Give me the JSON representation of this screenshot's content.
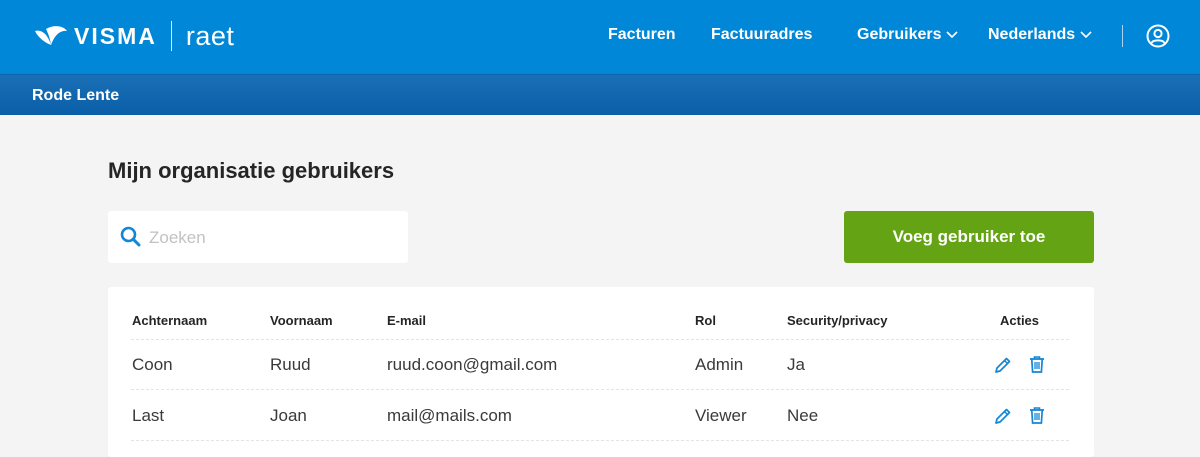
{
  "brand": {
    "logo_text": "VISMA",
    "product": "raet"
  },
  "nav": {
    "items": [
      {
        "label": "Facturen"
      },
      {
        "label": "Factuuradres"
      },
      {
        "label": "Gebruikers"
      },
      {
        "label": "Nederlands"
      }
    ]
  },
  "subheader": {
    "org_name": "Rode Lente"
  },
  "main": {
    "title": "Mijn organisatie gebruikers",
    "search": {
      "placeholder": "Zoeken",
      "value": ""
    },
    "add_button_label": "Voeg gebruiker toe"
  },
  "table": {
    "columns": [
      "Achternaam",
      "Voornaam",
      "E-mail",
      "Rol",
      "Security/privacy",
      "Acties"
    ],
    "rows": [
      {
        "achternaam": "Coon",
        "voornaam": "Ruud",
        "email": "ruud.coon@gmail.com",
        "rol": "Admin",
        "security": "Ja"
      },
      {
        "achternaam": "Last",
        "voornaam": "Joan",
        "email": "mail@mails.com",
        "rol": "Viewer",
        "security": "Nee"
      }
    ]
  },
  "colors": {
    "topbar": "#0087d8",
    "subbar": "#0a5fa8",
    "primary_button": "#64a414",
    "action_icon": "#1386d6",
    "page_background": "#f4f4f4"
  },
  "icons": {
    "logo": "visma-swoosh-icon",
    "dropdown": "chevron-down-icon",
    "user": "user-circle-icon",
    "search": "search-icon",
    "edit": "pencil-icon",
    "delete": "trash-icon"
  }
}
